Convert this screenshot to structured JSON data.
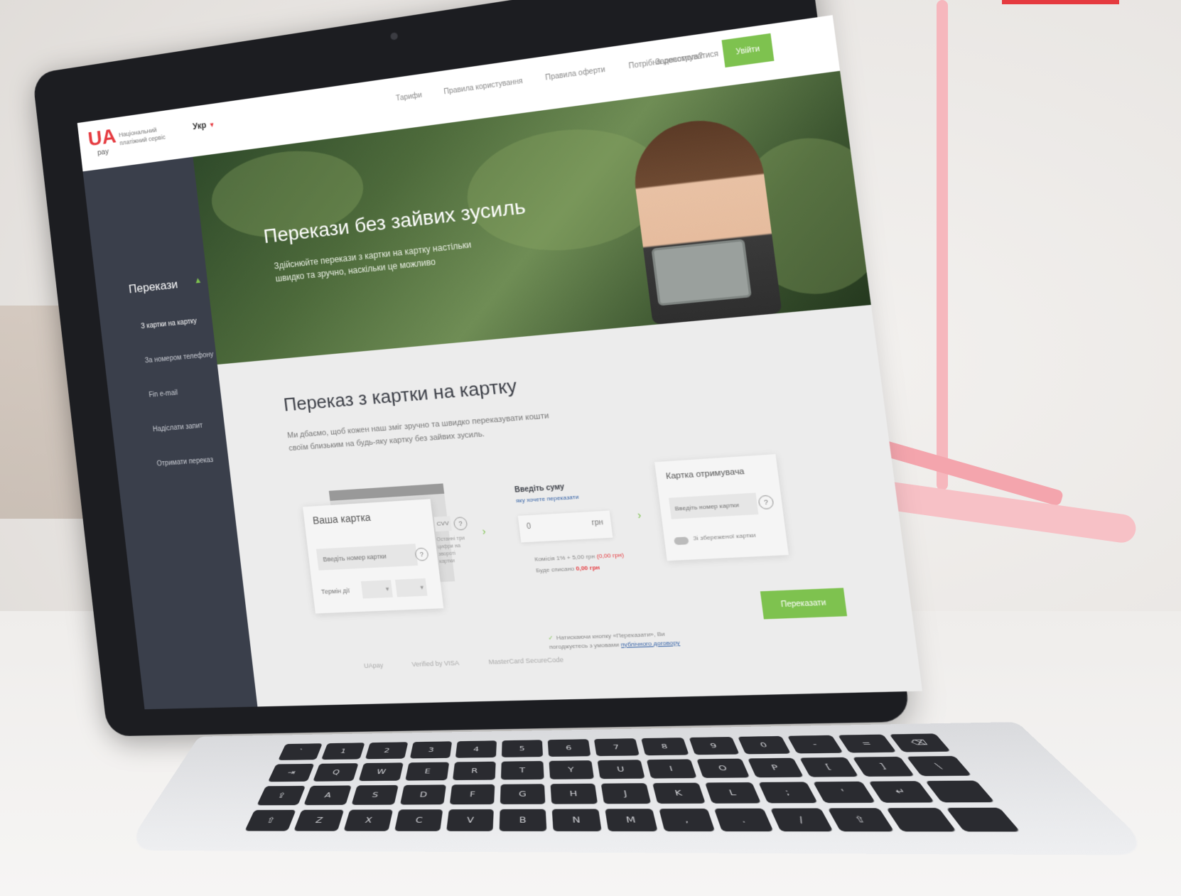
{
  "header": {
    "logo_mark": "UA",
    "logo_pay": "pay",
    "tagline": "Національний платіжний сервіс",
    "lang": "Укр",
    "nav": [
      "Тарифи",
      "Правила користування",
      "Правила оферти",
      "Потрібна допомога?"
    ],
    "login_link": "Зареєструватися",
    "signin_label": "Увійти"
  },
  "sidebar": {
    "section_title": "Перекази",
    "items": [
      {
        "label": "З картки на картку",
        "active": true
      },
      {
        "label": "За номером телефону",
        "active": false
      },
      {
        "label": "Fin e-mail",
        "active": false
      },
      {
        "label": "Надіслати запит",
        "active": false
      },
      {
        "label": "Отримати переказ",
        "active": false
      }
    ]
  },
  "hero": {
    "title": "Перекази без зайвих зусиль",
    "subtitle": "Здійснюйте перекази з картки на картку настільки швидко та зручно, наскільки це можливо"
  },
  "main": {
    "title": "Переказ з картки на картку",
    "description": "Ми дбаємо, щоб кожен наш зміг зручно та швидко переказувати кошти своїм близьким на будь-яку картку без зайвих зусиль."
  },
  "sender_card": {
    "label": "Ваша картка",
    "number_placeholder": "Введіть номер картки",
    "term_label": "Термін дії",
    "cvv_label": "CVV",
    "cvv_hint": "Останні три цифри на звороті картки"
  },
  "amount": {
    "title": "Введіть суму",
    "subtitle": "яку хочете переказати",
    "value": "0",
    "currency": "грн",
    "fee_text": "Комісія 1% + 5,00 грн",
    "fee_value": "(0,00 грн)",
    "total_text": "Буде списано",
    "total_value": "0,00 грн"
  },
  "receiver_card": {
    "label": "Картка отримувача",
    "number_placeholder": "Введіть номер картки",
    "toggle_label": "Зі збереженої картки"
  },
  "actions": {
    "transfer_label": "Переказати"
  },
  "terms": {
    "text": "Натискаючи кнопку «Переказати», Ви погоджуєтесь з умовами",
    "link": "публічного договору"
  },
  "payment_logos": [
    "UApay",
    "Verified by VISA",
    "MasterCard SecureCode"
  ],
  "keyboard": {
    "keys": [
      "`",
      "1",
      "2",
      "3",
      "4",
      "5",
      "6",
      "7",
      "8",
      "9",
      "0",
      "-",
      "=",
      "⌫",
      "⇥",
      "Q",
      "W",
      "E",
      "R",
      "T",
      "Y",
      "U",
      "I",
      "O",
      "P",
      "[",
      "]",
      "\\",
      "⇪",
      "A",
      "S",
      "D",
      "F",
      "G",
      "H",
      "J",
      "K",
      "L",
      ";",
      "'",
      "↵",
      "",
      "⇧",
      "Z",
      "X",
      "C",
      "V",
      "B",
      "N",
      "M",
      ",",
      ".",
      "/",
      "⇧",
      "",
      ""
    ]
  },
  "colors": {
    "brand_red": "#e53a3f",
    "accent_green": "#7ec24f",
    "sidebar": "#3a3f4b"
  }
}
